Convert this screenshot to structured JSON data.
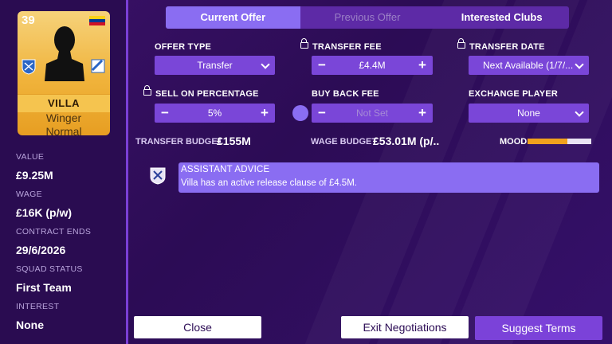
{
  "player": {
    "rating": "39",
    "name": "VILLA",
    "position": "Winger",
    "role": "Normal",
    "flag_colors": [
      "#fcd116",
      "#003893",
      "#ce1126"
    ]
  },
  "stats": [
    {
      "label": "VALUE",
      "value": "£9.25M"
    },
    {
      "label": "WAGE",
      "value": "£16K (p/w)"
    },
    {
      "label": "CONTRACT ENDS",
      "value": "29/6/2026"
    },
    {
      "label": "SQUAD STATUS",
      "value": "First Team"
    },
    {
      "label": "INTEREST",
      "value": "None"
    }
  ],
  "tabs": [
    {
      "label": "Current Offer"
    },
    {
      "label": "Previous Offer"
    },
    {
      "label": "Interested Clubs"
    }
  ],
  "offer": {
    "offer_type_label": "OFFER TYPE",
    "offer_type_value": "Transfer",
    "transfer_fee_label": "TRANSFER FEE",
    "transfer_fee_value": "£4.4M",
    "transfer_date_label": "TRANSFER DATE",
    "transfer_date_value": "Next Available (1/7/...",
    "sell_on_label": "SELL ON PERCENTAGE",
    "sell_on_value": "5%",
    "buy_back_label": "BUY BACK FEE",
    "buy_back_value": "Not Set",
    "exchange_label": "EXCHANGE PLAYER",
    "exchange_value": "None",
    "minus": "−",
    "plus": "+"
  },
  "budget": {
    "transfer_label": "TRANSFER BUDGET",
    "transfer_value": "£155M",
    "wage_label": "WAGE BUDGET",
    "wage_value": "£53.01M (p/..",
    "mood_label": "MOOD",
    "mood_level": 0.62
  },
  "advice": {
    "title": "ASSISTANT ADVICE",
    "body": "Villa has an active release clause of £4.5M."
  },
  "buttons": {
    "close": "Close",
    "exit": "Exit Negotiations",
    "suggest": "Suggest Terms"
  },
  "colors": {
    "accent": "#8a6df2",
    "control": "#7a46d8",
    "mood": "#f1a21d"
  }
}
